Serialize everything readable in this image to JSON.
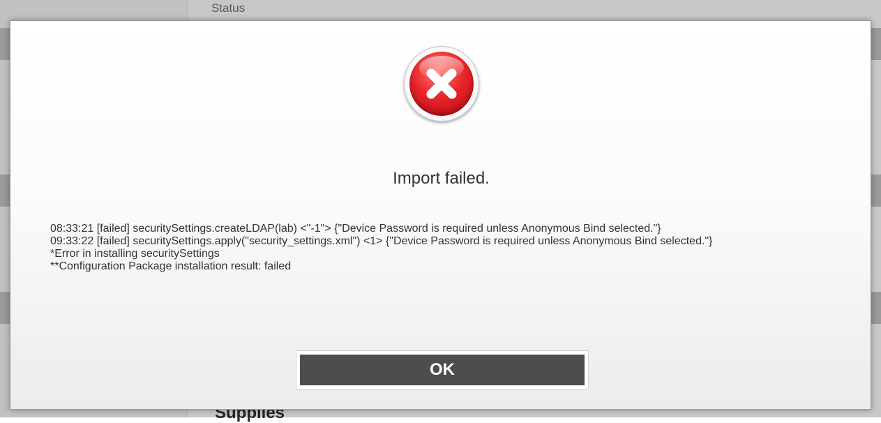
{
  "background": {
    "status_label": "Status",
    "supplies_label": "Supplies"
  },
  "dialog": {
    "icon": "error-icon",
    "title": "Import failed.",
    "log_lines": [
      "08:33:21 [failed] securitySettings.createLDAP(lab) <\"-1\"> {\"Device Password is required unless Anonymous Bind selected.\"}",
      "09:33:22 [failed] securitySettings.apply(\"security_settings.xml\") <1> {\"Device Password is required unless Anonymous Bind selected.\"}",
      "*Error in installing securitySettings",
      "**Configuration Package installation result: failed"
    ],
    "ok_label": "OK"
  },
  "colors": {
    "error_red": "#e8262b",
    "button_bg": "#4d4d4d"
  }
}
